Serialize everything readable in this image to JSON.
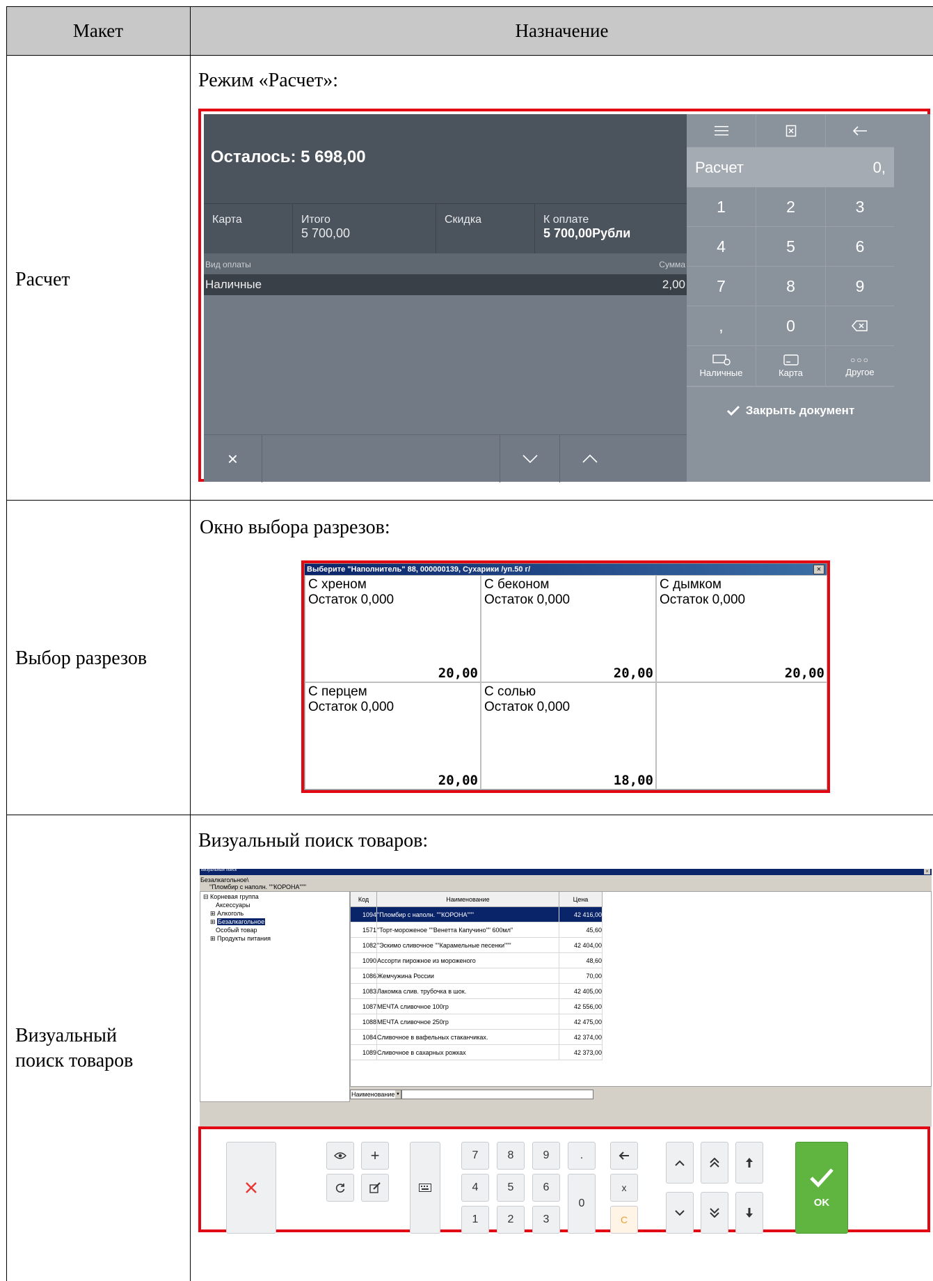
{
  "table": {
    "headers": [
      "Макет",
      "Назначение"
    ],
    "rows": [
      {
        "label": "Расчет",
        "caption": "Режим «Расчет»:"
      },
      {
        "label": "Выбор разрезов",
        "caption": "Окно выбора разрезов:"
      },
      {
        "label": "Визуальный поиск товаров",
        "caption": "Визуальный поиск товаров:"
      }
    ]
  },
  "screen1": {
    "remaining": "Осталось: 5 698,00",
    "totals": [
      {
        "label": "Карта",
        "value": ""
      },
      {
        "label": "Итого",
        "value": "5 700,00"
      },
      {
        "label": "Скидка",
        "value": ""
      },
      {
        "label": "К оплате",
        "value": "5 700,00Рубли"
      }
    ],
    "pay_header": {
      "type": "Вид оплаты",
      "sum": "Сумма"
    },
    "pay_rows": [
      {
        "type": "Наличные",
        "sum": "2,00"
      }
    ],
    "display": {
      "label": "Расчет",
      "value": "0,"
    },
    "keys": [
      "1",
      "2",
      "3",
      "4",
      "5",
      "6",
      "7",
      "8",
      "9",
      ",",
      "0"
    ],
    "pay_buttons": [
      "Наличные",
      "Карта",
      "Другое"
    ],
    "close_doc": "Закрыть документ"
  },
  "screen2": {
    "title": "Выберите \"Наполнитель\" 88, 000000139, Сухарики /уп.50 г/",
    "tiles": [
      {
        "name": "С хреном",
        "stock": "Остаток 0,000",
        "price": "20,00"
      },
      {
        "name": "С беконом",
        "stock": "Остаток 0,000",
        "price": "20,00"
      },
      {
        "name": "С дымком",
        "stock": "Остаток 0,000",
        "price": "20,00"
      },
      {
        "name": "С перцем",
        "stock": "Остаток 0,000",
        "price": "20,00"
      },
      {
        "name": "С солью",
        "stock": "Остаток 0,000",
        "price": "18,00"
      }
    ]
  },
  "screen3": {
    "window_title": "Визуальный поиск",
    "path1": "Безалкагольное\\",
    "path2": "\"Пломбир с наполн. \"\"КОРОНА\"\"\"",
    "tree": [
      "Корневая группа",
      "Аксессуары",
      "Алкоголь",
      "Безалкагольное",
      "Особый товар",
      "Продукты питания"
    ],
    "columns": [
      "Код",
      "Наименование",
      "Цена"
    ],
    "rows": [
      {
        "code": "1094",
        "name": "\"Пломбир с наполн. \"\"КОРОНА\"\"\"",
        "price": "42 416,00"
      },
      {
        "code": "1571",
        "name": "\"Торт-мороженое \"\"Венетта Капучино\"\" 600мл\"",
        "price": "45,60"
      },
      {
        "code": "1082",
        "name": "\"Эскимо сливочное \"\"Карамельные песенки\"\"\"",
        "price": "42 404,00"
      },
      {
        "code": "1090",
        "name": "Ассорти пирожное из мороженого",
        "price": "48,60"
      },
      {
        "code": "1086",
        "name": "Жемчужина России",
        "price": "70,00"
      },
      {
        "code": "1083",
        "name": "Лакомка слив. трубочка в шок.",
        "price": "42 405,00"
      },
      {
        "code": "1087",
        "name": "МЕЧТА сливочное 100гр",
        "price": "42 556,00"
      },
      {
        "code": "1088",
        "name": "МЕЧТА сливочное 250гр",
        "price": "42 475,00"
      },
      {
        "code": "1084",
        "name": "Сливочное в вафельных стаканчиках.",
        "price": "42 374,00"
      },
      {
        "code": "1089",
        "name": "Сливочное в сахарных рожках",
        "price": "42 373,00"
      }
    ],
    "search_field": "Наименование",
    "digits": [
      "7",
      "8",
      "9",
      "4",
      "5",
      "6",
      "1",
      "2",
      "3"
    ],
    "zero": "0",
    "dot": ".",
    "x": "x",
    "c": "C",
    "ok": "OK"
  },
  "colors": {
    "red": "#e30613",
    "green": "#5fb53f",
    "dark": "#4b535d",
    "keypad": "#8a929c"
  }
}
